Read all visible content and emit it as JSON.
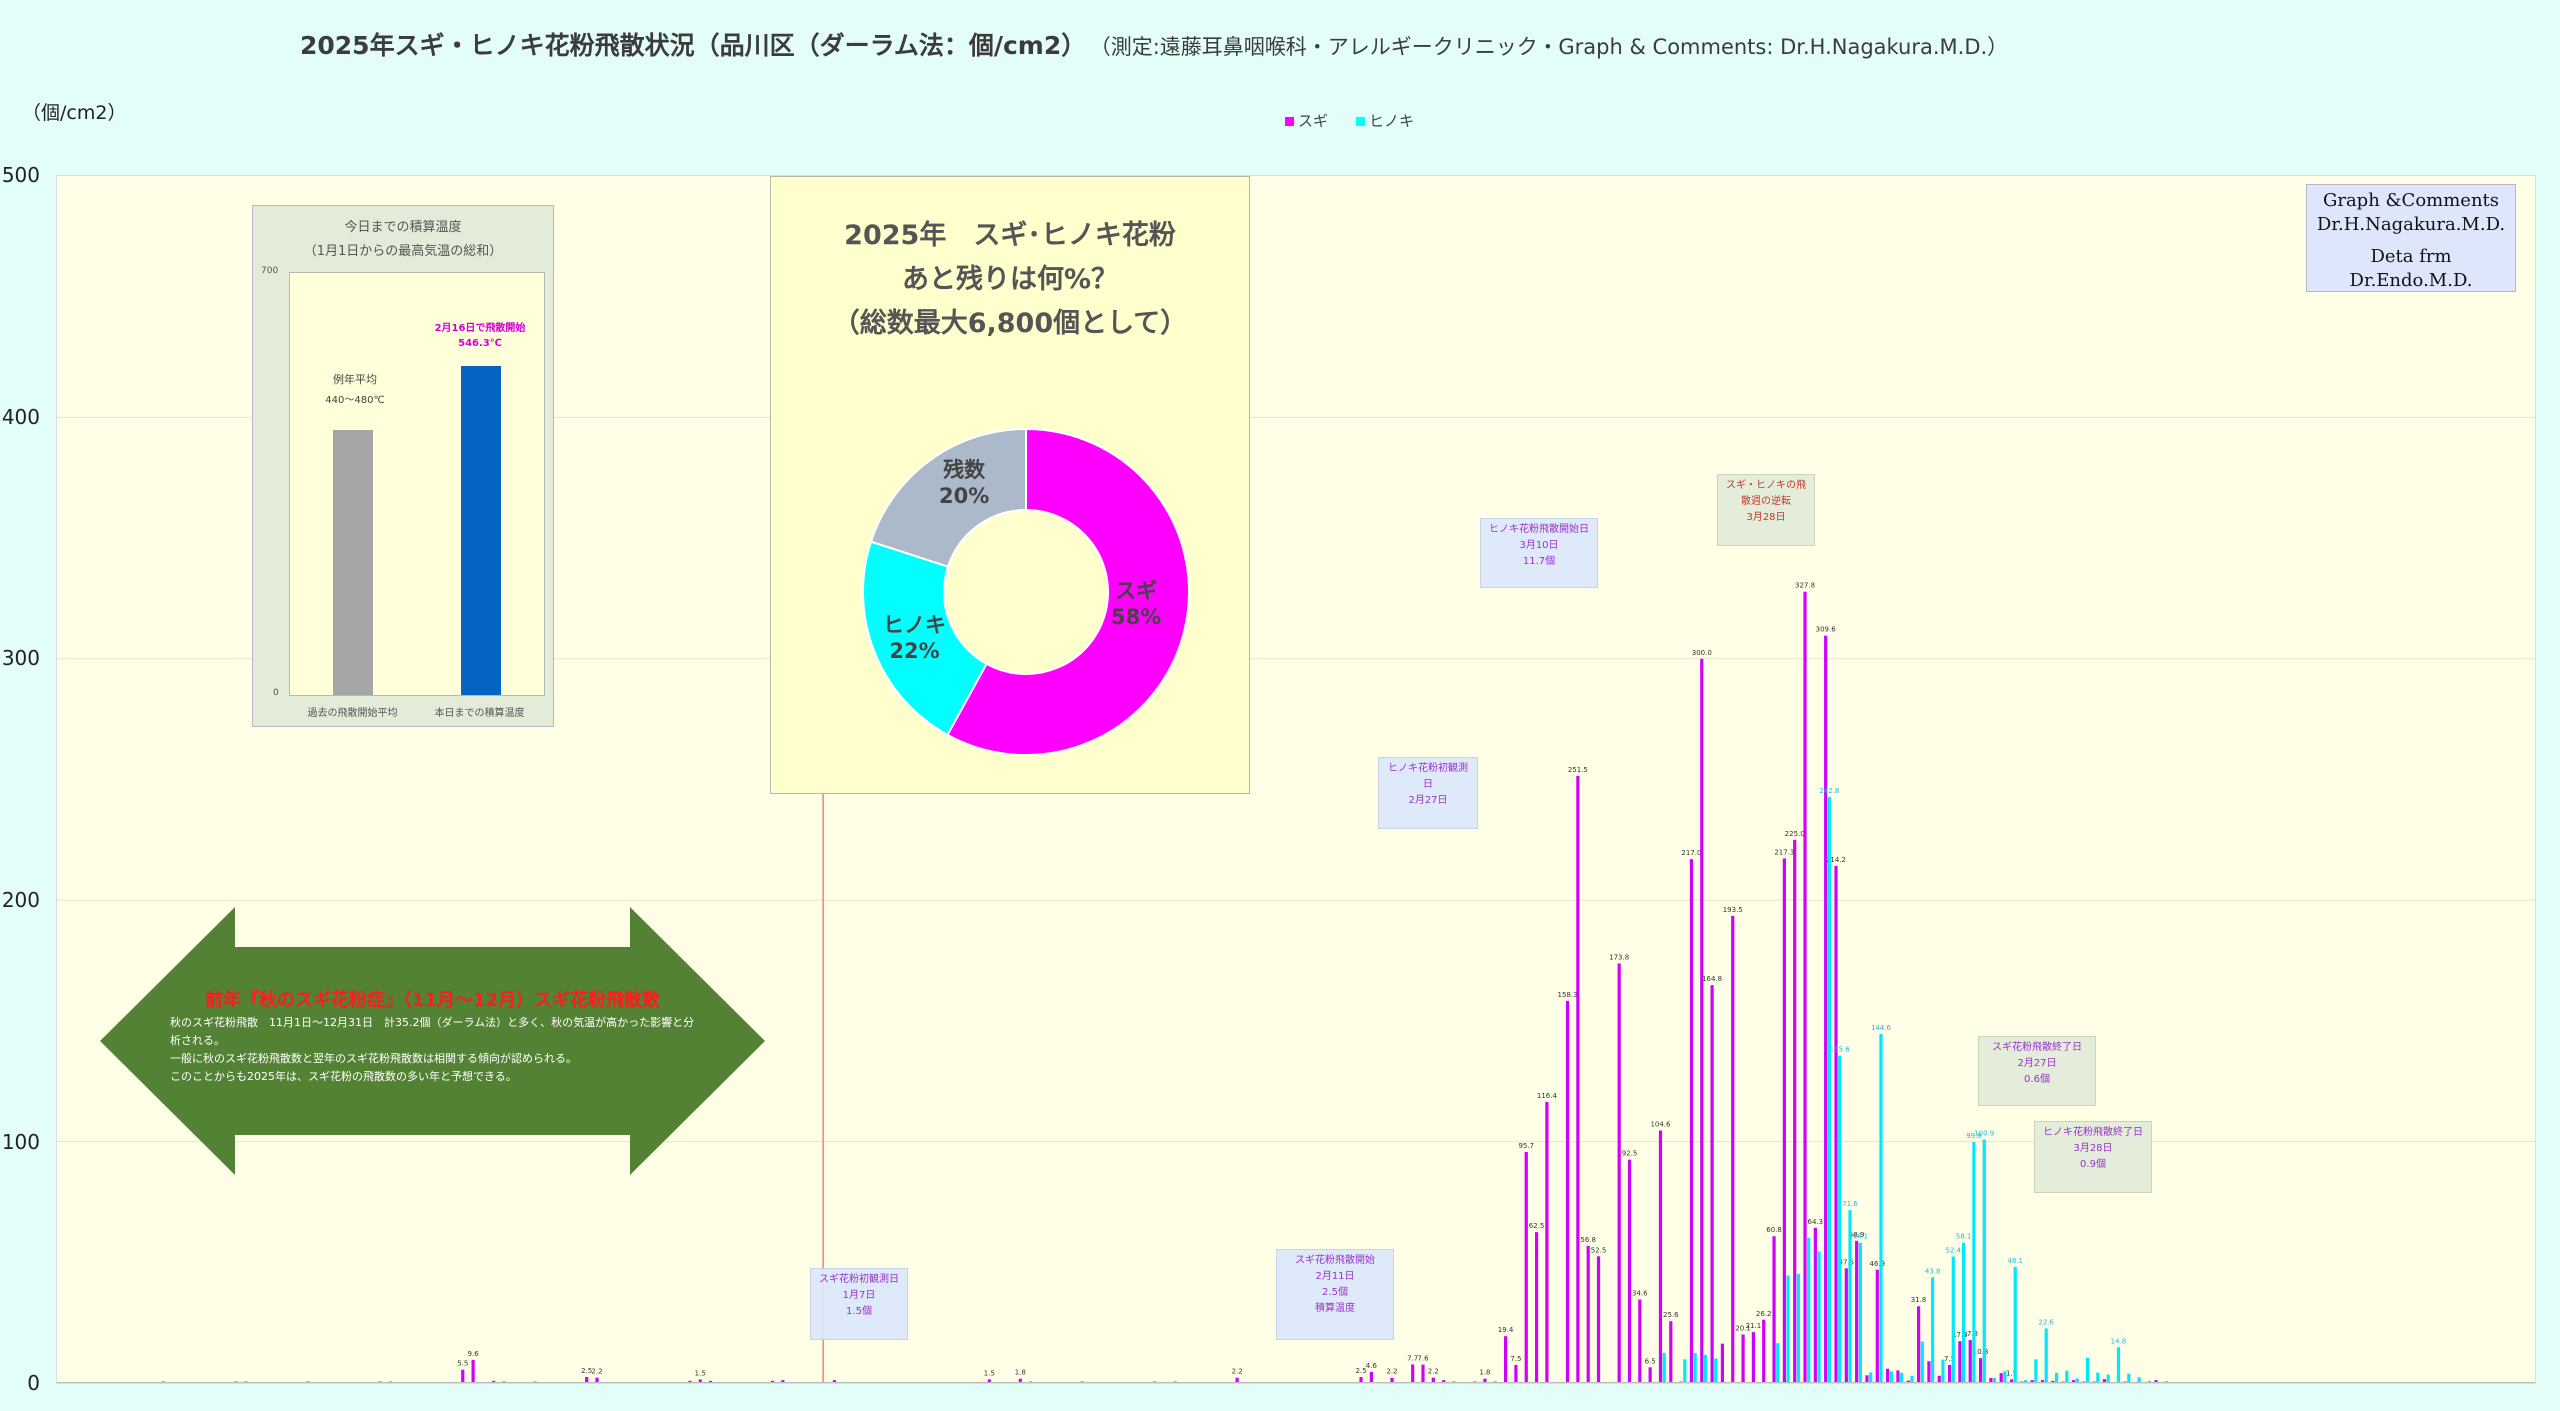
{
  "title": "2025年スギ・ヒノキ花粉飛散状況（品川区（ダーラム法：個/cm2）",
  "subtitle": "（測定:遠藤耳鼻咽喉科・アレルギークリニック・Graph & Comments: Dr.H.Nagakura.M.D.）",
  "y_unit": "（個/cm2）",
  "legend": [
    {
      "name": "スギ",
      "color": "#ff00ff"
    },
    {
      "name": "ヒノキ",
      "color": "#00ffff"
    }
  ],
  "credit": {
    "line1": "Graph &Comments",
    "line2": "Dr.H.Nagakura.M.D.",
    "line3": "Deta frm Dr.Endo.M.D."
  },
  "inset_temp": {
    "title1": "今日までの積算温度",
    "title2": "（1月1日からの最高気温の総和）",
    "ymax": "700",
    "ymin": "0",
    "bar1_note1": "例年平均",
    "bar1_note2": "440～480℃",
    "bar2_note1": "2月16日で飛散開始",
    "bar2_note2": "546.3℃",
    "cat1": "過去の飛散開始平均",
    "cat2": "本日までの積算温度",
    "values": [
      440,
      546.3
    ],
    "colors": [
      "#a5a5a5",
      "#0563c1"
    ]
  },
  "donut": {
    "title1": "2025年　スギ･ヒノキ花粉",
    "title2": "あと残りは何%？",
    "title3": "（総数最大6,800個として）",
    "slices": [
      {
        "label": "スギ",
        "pct": "58%",
        "value": 58,
        "color": "#ff00ff"
      },
      {
        "label": "ヒノキ",
        "pct": "22%",
        "value": 22,
        "color": "#00ffff"
      },
      {
        "label": "残数",
        "pct": "20%",
        "value": 20,
        "color": "#acb9ca"
      }
    ]
  },
  "arrow": {
    "heading": "前年『秋のスギ花粉症』（11月～12月）スギ花粉飛散数",
    "line1": "秋のスギ花粉飛散　11月1日～12月31日　計35.2個（ダーラム法）と多く、秋の気温が高かった影響と分析される。",
    "line2": "一般に秋のスギ花粉飛散数と翌年のスギ花粉飛散数は相関する傾向が認められる。",
    "line3": "このことからも2025年は、スギ花粉の飛散数の多い年と予想できる。",
    "color": "#548235"
  },
  "notes": [
    {
      "l1": "スギ花粉初観測日",
      "l2": "1月7日",
      "l3": "1.5個"
    },
    {
      "l1": "スギ花粉飛散開始",
      "l2": "2月11日",
      "l3": "2.5個",
      "l4": "積算温度"
    },
    {
      "l1": "ヒノキ花粉初観測",
      "l2": "日",
      "l3": "2月27日"
    },
    {
      "l1": "ヒノキ花粉飛散開始日",
      "l2": "3月10日",
      "l3": "11.7個"
    },
    {
      "l1": "スギ・ヒノキの飛",
      "l2": "散週の逆転",
      "l3": "3月28日"
    },
    {
      "l1": "スギ花粉飛散終了日",
      "l2": "2月27日",
      "l3": "0.6個"
    },
    {
      "l1": "ヒノキ花粉飛散終了日",
      "l2": "3月28日",
      "l3": "0.9個"
    }
  ],
  "chart_data": {
    "type": "bar",
    "ylim": [
      0,
      500
    ],
    "yticks": [
      "0",
      "100",
      "200",
      "300",
      "400",
      "500"
    ],
    "series_names": [
      "スギ",
      "ヒノキ"
    ],
    "sugi_labels": [
      "5.5",
      "9.6",
      "2.5",
      "2.2",
      "1.5",
      "1.8",
      "2.5",
      "4.6",
      "2.2",
      "7.7",
      "7.6",
      "19.4",
      "7.5",
      "95.7",
      "62.5",
      "116.4",
      "158.3",
      "251.5",
      "56.8",
      "52.5",
      "173.8",
      "92.5",
      "34.6",
      "6.5",
      "104.6",
      "25.6",
      "217.0",
      "300.0",
      "164.8",
      "193.5",
      "20.1",
      "21.1",
      "26.2",
      "60.8",
      "217.3",
      "225.0",
      "327.8",
      "64.3",
      "309.6",
      "214.2",
      "47.5",
      "58.9",
      "46.9",
      "31.8",
      "17.3",
      "17.8",
      "10.3"
    ],
    "hinoki_labels": [
      "135.6",
      "99.8",
      "100.9",
      "242.8",
      "71.6",
      "144.6",
      "43.8",
      "52.4",
      "58.1",
      "48.1",
      "22.6",
      "14.8"
    ],
    "sugi": [
      [
        6,
        0.2
      ],
      [
        8,
        0.3
      ],
      [
        9,
        0.3
      ],
      [
        10,
        0.6
      ],
      [
        12,
        0.3
      ],
      [
        14,
        0.3
      ],
      [
        17,
        0.6
      ],
      [
        18,
        0.6
      ],
      [
        20,
        0.3
      ],
      [
        21,
        0.3
      ],
      [
        24,
        0.6
      ],
      [
        26,
        0.3
      ],
      [
        28,
        0.3
      ],
      [
        31,
        0.6
      ],
      [
        32,
        0.6
      ],
      [
        34,
        0.3
      ],
      [
        37,
        0.3
      ],
      [
        39,
        5.5
      ],
      [
        40,
        9.6
      ],
      [
        42,
        0.9
      ],
      [
        43,
        0.6
      ],
      [
        44,
        0.3
      ],
      [
        46,
        0.6
      ],
      [
        47,
        0.3
      ],
      [
        48,
        0.3
      ],
      [
        51,
        2.5
      ],
      [
        52,
        2.2
      ],
      [
        54,
        0.3
      ],
      [
        56,
        0.3
      ],
      [
        58,
        0.3
      ],
      [
        61,
        0.9
      ],
      [
        62,
        1.5
      ],
      [
        63,
        0.9
      ],
      [
        65,
        0.3
      ],
      [
        67,
        0.3
      ],
      [
        69,
        0.9
      ],
      [
        70,
        1.2
      ],
      [
        72,
        0.3
      ],
      [
        73,
        0.3
      ],
      [
        75,
        1.2
      ],
      [
        77,
        0.3
      ],
      [
        78,
        0.3
      ],
      [
        80,
        0.3
      ],
      [
        82,
        0.3
      ],
      [
        90,
        1.5
      ],
      [
        93,
        1.8
      ],
      [
        94,
        0.6
      ],
      [
        97,
        0.3
      ],
      [
        99,
        0.6
      ],
      [
        100,
        0.3
      ],
      [
        104,
        0.3
      ],
      [
        106,
        0.6
      ],
      [
        108,
        0.6
      ],
      [
        110,
        0.3
      ],
      [
        112,
        0.3
      ],
      [
        114,
        2.2
      ],
      [
        117,
        0.3
      ],
      [
        119,
        0.3
      ],
      [
        121,
        0.3
      ],
      [
        126,
        2.5
      ],
      [
        127,
        4.6
      ],
      [
        129,
        2.2
      ],
      [
        131,
        7.7
      ],
      [
        132,
        7.6
      ],
      [
        133,
        2.2
      ],
      [
        134,
        1.2
      ],
      [
        135,
        0.6
      ],
      [
        136,
        0.3
      ],
      [
        137,
        0.6
      ],
      [
        138,
        1.8
      ],
      [
        139,
        0.6
      ],
      [
        140,
        19.4
      ],
      [
        141,
        7.5
      ],
      [
        142,
        95.7
      ],
      [
        143,
        62.5
      ],
      [
        144,
        116.4
      ],
      [
        146,
        158.3
      ],
      [
        147,
        251.5
      ],
      [
        148,
        56.8
      ],
      [
        149,
        52.5
      ],
      [
        150,
        0.3
      ],
      [
        151,
        173.8
      ],
      [
        152,
        92.5
      ],
      [
        153,
        34.6
      ],
      [
        154,
        6.5
      ],
      [
        155,
        104.6
      ],
      [
        156,
        25.6
      ],
      [
        157,
        0.6
      ],
      [
        158,
        217.0
      ],
      [
        159,
        300.0
      ],
      [
        160,
        164.8
      ],
      [
        161,
        16.3
      ],
      [
        162,
        193.5
      ],
      [
        163,
        20.1
      ],
      [
        164,
        21.1
      ],
      [
        165,
        26.2
      ],
      [
        166,
        60.8
      ],
      [
        167,
        217.3
      ],
      [
        168,
        225.0
      ],
      [
        169,
        327.8
      ],
      [
        170,
        64.3
      ],
      [
        171,
        309.6
      ],
      [
        172,
        214.2
      ],
      [
        173,
        47.5
      ],
      [
        174,
        58.9
      ],
      [
        175,
        3.2
      ],
      [
        176,
        46.9
      ],
      [
        177,
        5.9
      ],
      [
        178,
        5.2
      ],
      [
        179,
        1.0
      ],
      [
        180,
        31.8
      ],
      [
        181,
        9.0
      ],
      [
        182,
        3.0
      ],
      [
        183,
        7.5
      ],
      [
        184,
        17.3
      ],
      [
        185,
        17.8
      ],
      [
        186,
        10.3
      ],
      [
        187,
        2.1
      ],
      [
        188,
        4.1
      ],
      [
        189,
        1.5
      ],
      [
        190,
        0.6
      ],
      [
        191,
        1.2
      ],
      [
        192,
        1.2
      ],
      [
        193,
        0.9
      ],
      [
        194,
        0.6
      ],
      [
        195,
        1.2
      ],
      [
        196,
        0.6
      ],
      [
        197,
        0.6
      ],
      [
        198,
        1.6
      ],
      [
        199,
        0.3
      ],
      [
        200,
        0.6
      ],
      [
        201,
        0.3
      ],
      [
        202,
        0.3
      ],
      [
        203,
        1.2
      ],
      [
        204,
        0.6
      ],
      [
        206,
        0.3
      ],
      [
        208,
        0.3
      ],
      [
        209,
        0.3
      ],
      [
        210,
        0.3
      ]
    ],
    "hinoki": [
      [
        155,
        12.5
      ],
      [
        157,
        9.8
      ],
      [
        158,
        12.4
      ],
      [
        159,
        11.7
      ],
      [
        160,
        10.2
      ],
      [
        166,
        16.5
      ],
      [
        167,
        44.5
      ],
      [
        168,
        45.2
      ],
      [
        169,
        60.2
      ],
      [
        170,
        54.5
      ],
      [
        171,
        242.8
      ],
      [
        172,
        135.6
      ],
      [
        173,
        71.6
      ],
      [
        174,
        58.1
      ],
      [
        175,
        4.4
      ],
      [
        176,
        144.6
      ],
      [
        177,
        4.8
      ],
      [
        178,
        4.2
      ],
      [
        179,
        3.0
      ],
      [
        180,
        17.2
      ],
      [
        181,
        43.8
      ],
      [
        182,
        9.7
      ],
      [
        183,
        52.4
      ],
      [
        184,
        58.1
      ],
      [
        185,
        99.8
      ],
      [
        186,
        100.9
      ],
      [
        187,
        2.1
      ],
      [
        188,
        4.9
      ],
      [
        189,
        48.1
      ],
      [
        190,
        1.2
      ],
      [
        191,
        9.8
      ],
      [
        192,
        22.6
      ],
      [
        193,
        4.2
      ],
      [
        194,
        5.1
      ],
      [
        195,
        1.9
      ],
      [
        196,
        10.5
      ],
      [
        197,
        4.3
      ],
      [
        198,
        3.5
      ],
      [
        199,
        14.8
      ],
      [
        200,
        3.9
      ],
      [
        201,
        2.4
      ],
      [
        202,
        0.9
      ]
    ]
  }
}
